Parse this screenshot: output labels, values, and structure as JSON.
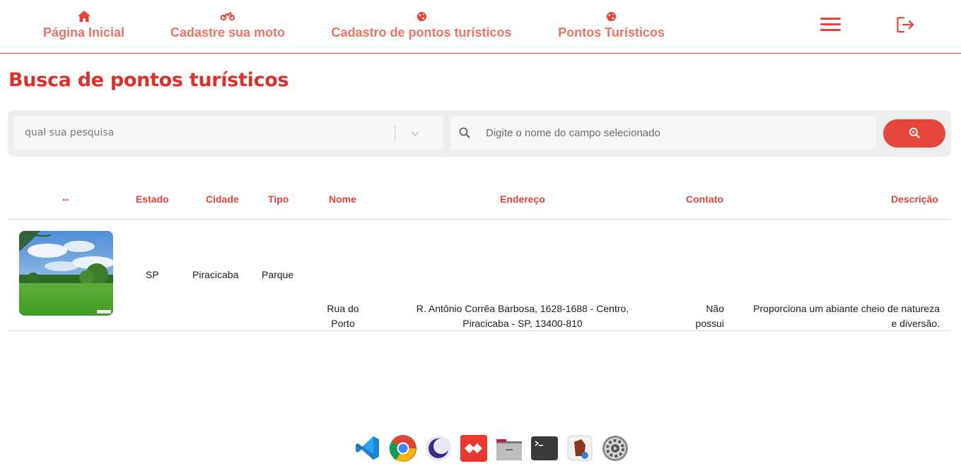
{
  "colors": {
    "accent": "#e5443a",
    "nav_text": "#ec7466",
    "title": "#d8322a"
  },
  "nav": {
    "items": [
      {
        "label": "Página Inicial",
        "icon": "home-icon"
      },
      {
        "label": "Cadastre sua moto",
        "icon": "motorcycle-icon"
      },
      {
        "label": "Cadastro de pontos turísticos",
        "icon": "globe-icon"
      },
      {
        "label": "Pontos Turísticos",
        "icon": "globe-icon"
      }
    ],
    "menu_icon": "hamburger-menu-icon",
    "logout_icon": "logout-icon"
  },
  "page": {
    "title": "Busca de pontos turísticos"
  },
  "search": {
    "select_placeholder": "qual sua pesquisa",
    "input_placeholder": "Digite o nome do campo selecionado",
    "input_value": "",
    "button_icon": "search-icon"
  },
  "table": {
    "headers": [
      "--",
      "Estado",
      "Cidade",
      "Tipo",
      "Nome",
      "Endereço",
      "Contato",
      "Descrição"
    ],
    "rows": [
      {
        "image": "park-photo",
        "estado": "SP",
        "cidade": "Piracicaba",
        "tipo": "Parque",
        "nome_line1": "Rua do",
        "nome_line2": "Porto",
        "endereco_line1": "R. Antônio Corrêa Barbosa, 1628-1688 - Centro,",
        "endereco_line2": "Piracicaba - SP, 13400-810",
        "contato_line1": "Não",
        "contato_line2": "possui",
        "descricao_line1": "Proporciona um abiante cheio de natureza",
        "descricao_line2": "e diversão."
      }
    ]
  },
  "dock": {
    "apps": [
      "vscode-icon",
      "chrome-icon",
      "eclipse-icon",
      "anydesk-icon",
      "files-icon",
      "terminal-icon",
      "beekeeper-icon",
      "settings-icon"
    ]
  }
}
